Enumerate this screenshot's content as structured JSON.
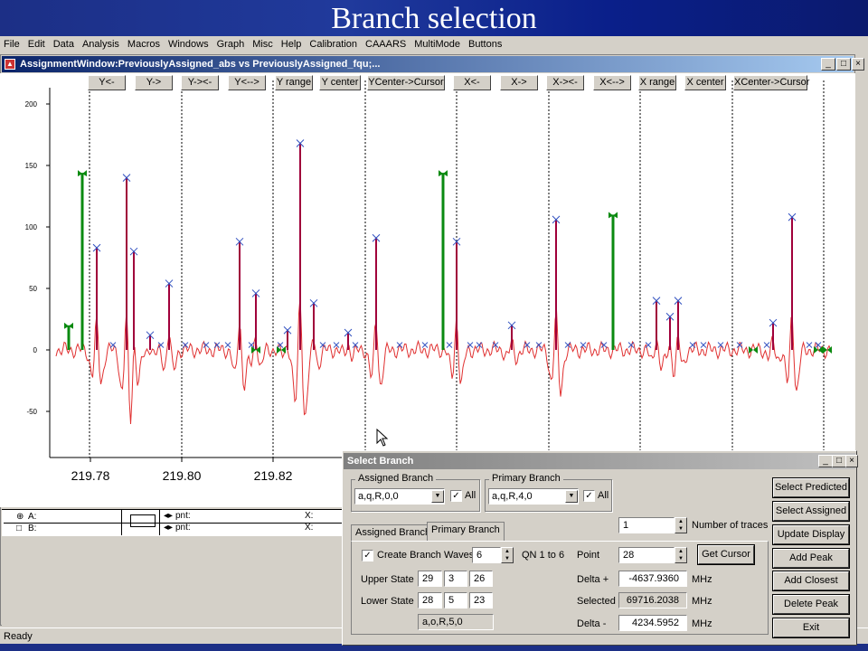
{
  "slide": {
    "title": "Branch selection"
  },
  "menu": [
    "File",
    "Edit",
    "Data",
    "Analysis",
    "Macros",
    "Windows",
    "Graph",
    "Misc",
    "Help",
    "Calibration",
    "CAAARS",
    "MultiMode",
    "Buttons"
  ],
  "graph_window": {
    "title": "AssignmentWindow:PreviouslyAssigned_abs vs PreviouslyAssigned_fqu;...",
    "buttons": [
      "Y<-",
      "Y->",
      "Y-><-",
      "Y<-->",
      "Y range",
      "Y center",
      "YCenter->Cursor",
      "X<-",
      "X->",
      "X-><-",
      "X<-->",
      "X range",
      "X center",
      "XCenter->Cursor"
    ],
    "legend": {
      "a_label": "A:",
      "b_label": "B:",
      "pnt": "pnt:",
      "x": "X:"
    }
  },
  "chart_data": {
    "type": "line",
    "y_ticks": [
      200,
      150,
      100,
      50,
      0,
      -50
    ],
    "ylim": [
      -85,
      215
    ],
    "x_ticks": [
      "219.78",
      "219.80",
      "219.82"
    ],
    "series_colors": {
      "spectrum": "#e03030",
      "assigned": "#a0003a",
      "markers": "#3050c0",
      "branch": "#0a8a10"
    }
  },
  "status": {
    "text": "Ready"
  },
  "dialog": {
    "title": "Select Branch",
    "assigned_branch": {
      "label": "Assigned Branch",
      "value": "a,q,R,0,0",
      "all": "All"
    },
    "primary_branch": {
      "label": "Primary Branch",
      "value": "a,q,R,4,0",
      "all": "All"
    },
    "traces": {
      "value": "1",
      "label": "Number of traces"
    },
    "tabs": [
      "Assigned Branch",
      "Primary Branch"
    ],
    "create_waves": {
      "label": "Create Branch Waves",
      "value": "6",
      "range": "QN 1 to 6"
    },
    "upper_state": {
      "label": "Upper State",
      "v1": "29",
      "v2": "3",
      "v3": "26"
    },
    "lower_state": {
      "label": "Lower State",
      "v1": "28",
      "v2": "5",
      "v3": "23"
    },
    "branch_readout": "a,o,R,5,0",
    "point": {
      "label": "Point",
      "value": "28",
      "button": "Get Cursor"
    },
    "delta_plus": {
      "label": "Delta +",
      "value": "-4637.9360",
      "unit": "MHz"
    },
    "selected": {
      "label": "Selected",
      "value": "69716.2038",
      "unit": "MHz"
    },
    "delta_minus": {
      "label": "Delta -",
      "value": "4234.5952",
      "unit": "MHz"
    },
    "side_buttons": [
      "Select Predicted",
      "Select Assigned",
      "Update Display",
      "Add Peak",
      "Add Closest",
      "Delete Peak",
      "Exit"
    ]
  }
}
